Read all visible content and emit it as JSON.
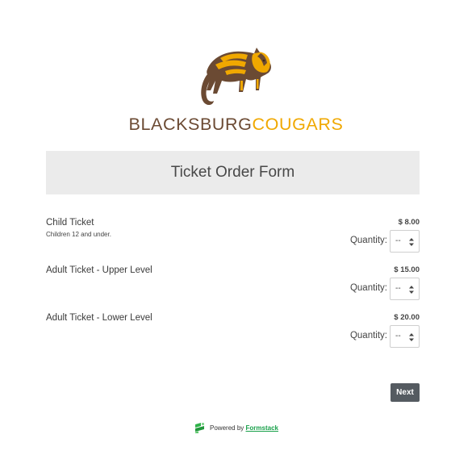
{
  "brand": {
    "logo_icon": "cougar-icon",
    "name_part1": "BLACKSBURG",
    "name_part2": "COUGARS",
    "color_brown": "#6b4a33",
    "color_gold": "#f0a800"
  },
  "form": {
    "title": "Ticket Order Form"
  },
  "tickets": [
    {
      "name": "Child Ticket",
      "description": "Children 12 and under.",
      "price": "$ 8.00",
      "quantity_label": "Quantity:",
      "quantity_value": "--"
    },
    {
      "name": "Adult Ticket - Upper Level",
      "description": "",
      "price": "$ 15.00",
      "quantity_label": "Quantity:",
      "quantity_value": "--"
    },
    {
      "name": "Adult Ticket - Lower Level",
      "description": "",
      "price": "$ 20.00",
      "quantity_label": "Quantity:",
      "quantity_value": "--"
    }
  ],
  "actions": {
    "next_label": "Next",
    "next_color": "#555b61"
  },
  "footer": {
    "powered_by": "Powered by",
    "link_text": "Formstack",
    "link_color": "#18a04a",
    "icon": "formstack-icon"
  }
}
